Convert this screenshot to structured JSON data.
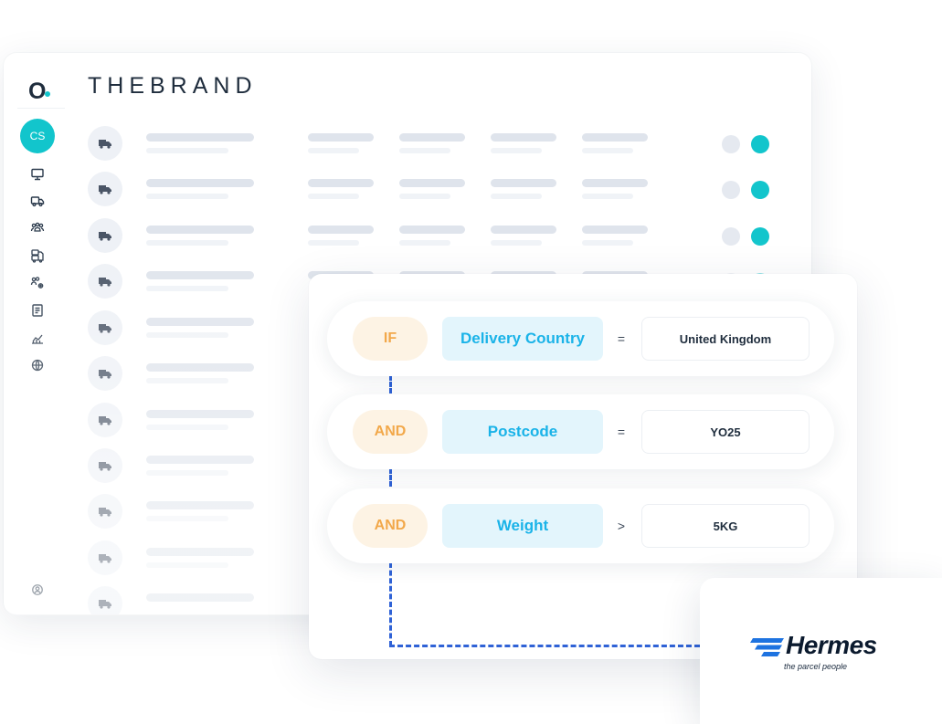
{
  "brand": {
    "mark": "O",
    "name": "THEBRAND"
  },
  "user": {
    "initials": "CS"
  },
  "sidebar": {
    "icons": [
      "monitor-icon",
      "truck-icon",
      "users-icon",
      "trucks-icon",
      "user-settings-icon",
      "document-icon",
      "analytics-icon",
      "globe-icon"
    ],
    "footer_icon": "account-icon"
  },
  "rules": [
    {
      "operator": "IF",
      "field": "Delivery Country",
      "comparator": "=",
      "value": "United Kingdom"
    },
    {
      "operator": "AND",
      "field": "Postcode",
      "comparator": "=",
      "value": "YO25"
    },
    {
      "operator": "AND",
      "field": "Weight",
      "comparator": ">",
      "value": "5KG"
    }
  ],
  "carrier": {
    "name": "Hermes",
    "tagline": "the parcel people"
  },
  "colors": {
    "accent": "#12c5cc",
    "operator": "#f2a84a",
    "field": "#1ab3e8",
    "connector": "#2f62d6"
  }
}
